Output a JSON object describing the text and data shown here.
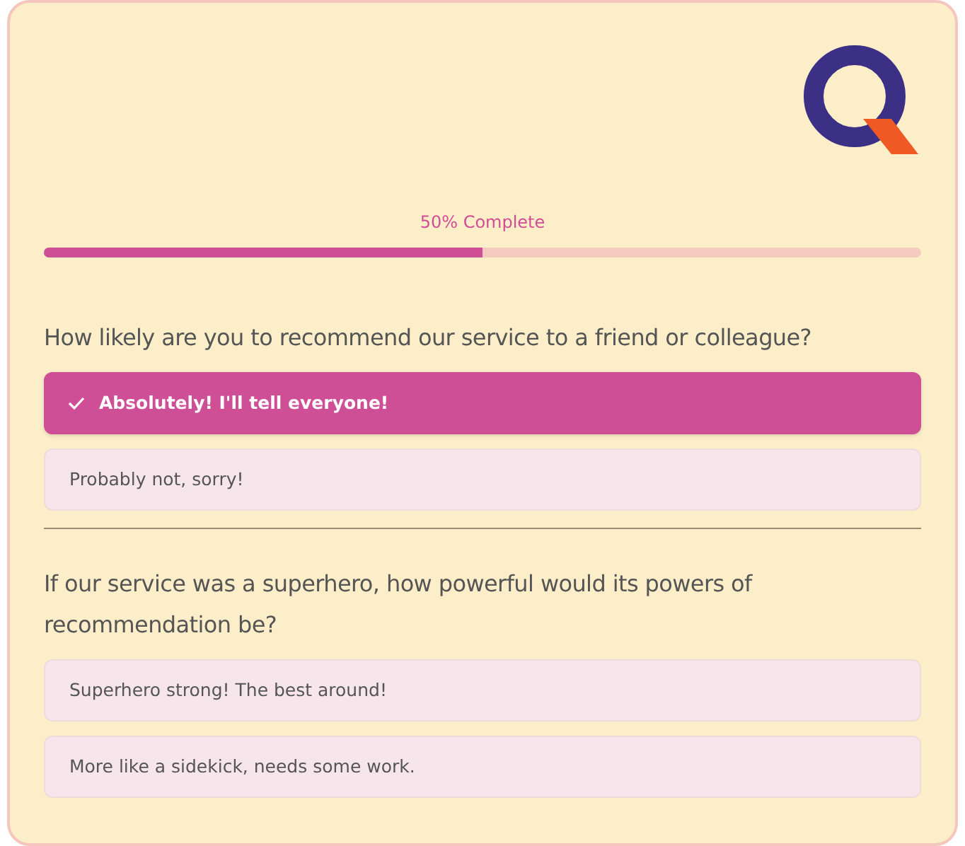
{
  "progress": {
    "label": "50% Complete",
    "level": 0.5
  },
  "questions": [
    {
      "text": "How likely are you to recommend our service to a friend or colleague?",
      "options": [
        {
          "label": "Absolutely! I'll tell everyone!",
          "selected": true
        },
        {
          "label": "Probably not, sorry!",
          "selected": false
        }
      ]
    },
    {
      "text": "If our service was a superhero, how powerful would its powers of recommendation be?",
      "options": [
        {
          "label": "Superhero strong! The best around!",
          "selected": false
        },
        {
          "label": "More like a sidekick, needs some work.",
          "selected": false
        }
      ]
    }
  ]
}
